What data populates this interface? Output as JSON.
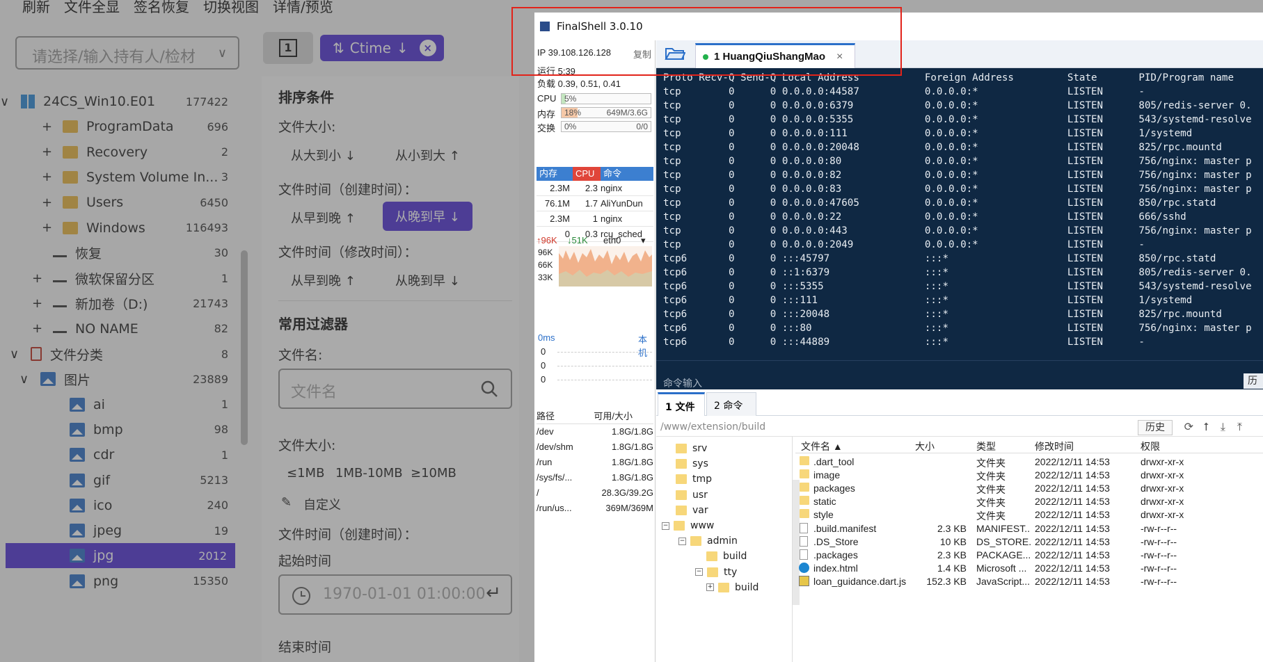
{
  "bg": {
    "menu": [
      "刷新",
      "文件全显",
      "签名恢复",
      "切换视图",
      "详情/预览"
    ],
    "owner_placeholder": "请选择/输入持有人/检材",
    "view_icon_label": "1",
    "sort_chip": "Ctime",
    "tree": [
      {
        "label": "24CS_Win10.E01",
        "count": "177422",
        "kind": "win",
        "prefix": "v"
      },
      {
        "label": "ProgramData",
        "count": "696",
        "kind": "folder",
        "prefix": "+"
      },
      {
        "label": "Recovery",
        "count": "2",
        "kind": "folder",
        "prefix": "+"
      },
      {
        "label": "System Volume In...",
        "count": "3",
        "kind": "folder",
        "prefix": "+"
      },
      {
        "label": "Users",
        "count": "6450",
        "kind": "folder",
        "prefix": "+"
      },
      {
        "label": "Windows",
        "count": "116493",
        "kind": "folder",
        "prefix": "+"
      },
      {
        "label": "恢复",
        "count": "30",
        "kind": "drive",
        "prefix": ""
      },
      {
        "label": "微软保留分区",
        "count": "1",
        "kind": "drive",
        "prefix": "+"
      },
      {
        "label": "新加卷（D:)",
        "count": "21743",
        "kind": "drive",
        "prefix": "+"
      },
      {
        "label": "NO NAME",
        "count": "82",
        "kind": "drive",
        "prefix": "+"
      },
      {
        "label": "文件分类",
        "count": "8",
        "kind": "class",
        "prefix": "v"
      },
      {
        "label": "图片",
        "count": "23889",
        "kind": "img",
        "prefix": "v"
      },
      {
        "label": "ai",
        "count": "1",
        "kind": "img",
        "prefix": ""
      },
      {
        "label": "bmp",
        "count": "98",
        "kind": "img",
        "prefix": ""
      },
      {
        "label": "cdr",
        "count": "1",
        "kind": "img",
        "prefix": ""
      },
      {
        "label": "gif",
        "count": "5213",
        "kind": "img",
        "prefix": ""
      },
      {
        "label": "ico",
        "count": "240",
        "kind": "img",
        "prefix": ""
      },
      {
        "label": "jpeg",
        "count": "19",
        "kind": "img",
        "prefix": ""
      },
      {
        "label": "jpg",
        "count": "2012",
        "kind": "img",
        "prefix": "",
        "selected": true
      },
      {
        "label": "png",
        "count": "15350",
        "kind": "img",
        "prefix": ""
      }
    ],
    "filter": {
      "title": "排序条件",
      "size_label": "文件大小:",
      "size_desc": "从大到小 ↓",
      "size_asc": "从小到大 ↑",
      "ctime_label": "文件时间（创建时间）：",
      "ctime_asc": "从早到晚 ↑",
      "ctime_desc": "从晚到早 ↓",
      "mtime_label": "文件时间（修改时间）：",
      "mtime_asc": "从早到晚 ↑",
      "mtime_desc": "从晚到早 ↓",
      "common_title": "常用过滤器",
      "name_label": "文件名:",
      "name_placeholder": "文件名",
      "size2_label": "文件大小:",
      "size_opts": [
        "≤1MB",
        "1MB-10MB",
        "≥10MB"
      ],
      "custom": "自定义",
      "ctime2_label": "文件时间（创建时间）：",
      "start_label": "起始时间",
      "start_value": "1970-01-01 01:00:00",
      "end_label": "结束时间"
    }
  },
  "fs": {
    "title": "FinalShell 3.0.10",
    "ip": "IP 39.108.126.128",
    "copy": "复制",
    "uptime": "运行 5:39",
    "load": "负载 0.39, 0.51, 0.41",
    "cpu_label": "CPU",
    "cpu_val": "5%",
    "cpu_frac": 0.05,
    "mem_label": "内存",
    "mem_pct": "18%",
    "mem_frac": 0.18,
    "mem_val": "649M/3.6G",
    "swap_label": "交换",
    "swap_pct": "0%",
    "swap_val": "0/0",
    "proc_head": [
      "内存",
      "CPU",
      "命令"
    ],
    "procs": [
      [
        "2.3M",
        "2.3",
        "nginx"
      ],
      [
        "76.1M",
        "1.7",
        "AliYunDun"
      ],
      [
        "2.3M",
        "1",
        "nginx"
      ],
      [
        "0",
        "0.3",
        "rcu_sched"
      ]
    ],
    "net_up": "↑96K",
    "net_down": "↓51K",
    "net_if": "eth0",
    "net_ticks": [
      "96K",
      "66K",
      "33K"
    ],
    "lat_label": "0ms",
    "lat_host": "本机",
    "lat_ticks": [
      "0",
      "0",
      "0"
    ],
    "disk_head": [
      "路径",
      "可用/大小"
    ],
    "disks": [
      [
        "/dev",
        "1.8G/1.8G"
      ],
      [
        "/dev/shm",
        "1.8G/1.8G"
      ],
      [
        "/run",
        "1.8G/1.8G"
      ],
      [
        "/sys/fs/...",
        "1.8G/1.8G"
      ],
      [
        "/",
        "28.3G/39.2G"
      ],
      [
        "/run/us...",
        "369M/369M"
      ]
    ],
    "session_tab": "1 HuangQiuShangMao",
    "terminal_header": "Proto Recv-Q Send-Q Local Address           Foreign Address         State       PID/Program name",
    "terminal_rows": [
      "tcp        0      0 0.0.0.0:44587           0.0.0.0:*               LISTEN      -",
      "tcp        0      0 0.0.0.0:6379            0.0.0.0:*               LISTEN      805/redis-server 0.",
      "tcp        0      0 0.0.0.0:5355            0.0.0.0:*               LISTEN      543/systemd-resolve",
      "tcp        0      0 0.0.0.0:111             0.0.0.0:*               LISTEN      1/systemd",
      "tcp        0      0 0.0.0.0:20048           0.0.0.0:*               LISTEN      825/rpc.mountd",
      "tcp        0      0 0.0.0.0:80              0.0.0.0:*               LISTEN      756/nginx: master p",
      "tcp        0      0 0.0.0.0:82              0.0.0.0:*               LISTEN      756/nginx: master p",
      "tcp        0      0 0.0.0.0:83              0.0.0.0:*               LISTEN      756/nginx: master p",
      "tcp        0      0 0.0.0.0:47605           0.0.0.0:*               LISTEN      850/rpc.statd",
      "tcp        0      0 0.0.0.0:22              0.0.0.0:*               LISTEN      666/sshd",
      "tcp        0      0 0.0.0.0:443             0.0.0.0:*               LISTEN      756/nginx: master p",
      "tcp        0      0 0.0.0.0:2049            0.0.0.0:*               LISTEN      -",
      "tcp6       0      0 :::45797                :::*                    LISTEN      850/rpc.statd",
      "tcp6       0      0 ::1:6379                :::*                    LISTEN      805/redis-server 0.",
      "tcp6       0      0 :::5355                 :::*                    LISTEN      543/systemd-resolve",
      "tcp6       0      0 :::111                  :::*                    LISTEN      1/systemd",
      "tcp6       0      0 :::20048                :::*                    LISTEN      825/rpc.mountd",
      "tcp6       0      0 :::80                   :::*                    LISTEN      756/nginx: master p",
      "tcp6       0      0 :::44889                :::*                    LISTEN      -"
    ],
    "cmd_label": "命令输入",
    "cmd_hist": "历",
    "btab_files": "1 文件",
    "btab_cmds": "2 命令",
    "path": "/www/extension/build",
    "history_btn": "历史",
    "dir_tree": [
      {
        "label": "srv",
        "expand": ""
      },
      {
        "label": "sys",
        "expand": ""
      },
      {
        "label": "tmp",
        "expand": ""
      },
      {
        "label": "usr",
        "expand": ""
      },
      {
        "label": "var",
        "expand": ""
      },
      {
        "label": "www",
        "expand": "−"
      },
      {
        "label": "admin",
        "expand": "−"
      },
      {
        "label": "build",
        "expand": ""
      },
      {
        "label": "tty",
        "expand": "−"
      },
      {
        "label": "build",
        "expand": "+"
      }
    ],
    "file_head": [
      "文件名 ▲",
      "大小",
      "类型",
      "修改时间",
      "权限"
    ],
    "files": [
      {
        "name": ".dart_tool",
        "size": "",
        "type": "文件夹",
        "mtime": "2022/12/11 14:53",
        "perm": "drwxr-xr-x",
        "icon": "folder"
      },
      {
        "name": "image",
        "size": "",
        "type": "文件夹",
        "mtime": "2022/12/11 14:53",
        "perm": "drwxr-xr-x",
        "icon": "folder"
      },
      {
        "name": "packages",
        "size": "",
        "type": "文件夹",
        "mtime": "2022/12/11 14:53",
        "perm": "drwxr-xr-x",
        "icon": "folder"
      },
      {
        "name": "static",
        "size": "",
        "type": "文件夹",
        "mtime": "2022/12/11 14:53",
        "perm": "drwxr-xr-x",
        "icon": "folder"
      },
      {
        "name": "style",
        "size": "",
        "type": "文件夹",
        "mtime": "2022/12/11 14:53",
        "perm": "drwxr-xr-x",
        "icon": "folder"
      },
      {
        "name": ".build.manifest",
        "size": "2.3 KB",
        "type": "MANIFEST...",
        "mtime": "2022/12/11 14:53",
        "perm": "-rw-r--r--",
        "icon": "file"
      },
      {
        "name": ".DS_Store",
        "size": "10 KB",
        "type": "DS_STORE...",
        "mtime": "2022/12/11 14:53",
        "perm": "-rw-r--r--",
        "icon": "file"
      },
      {
        "name": ".packages",
        "size": "2.3 KB",
        "type": "PACKAGE...",
        "mtime": "2022/12/11 14:53",
        "perm": "-rw-r--r--",
        "icon": "file"
      },
      {
        "name": "index.html",
        "size": "1.4 KB",
        "type": "Microsoft ...",
        "mtime": "2022/12/11 14:53",
        "perm": "-rw-r--r--",
        "icon": "edge"
      },
      {
        "name": "loan_guidance.dart.js",
        "size": "152.3 KB",
        "type": "JavaScript...",
        "mtime": "2022/12/11 14:53",
        "perm": "-rw-r--r--",
        "icon": "js"
      }
    ]
  }
}
